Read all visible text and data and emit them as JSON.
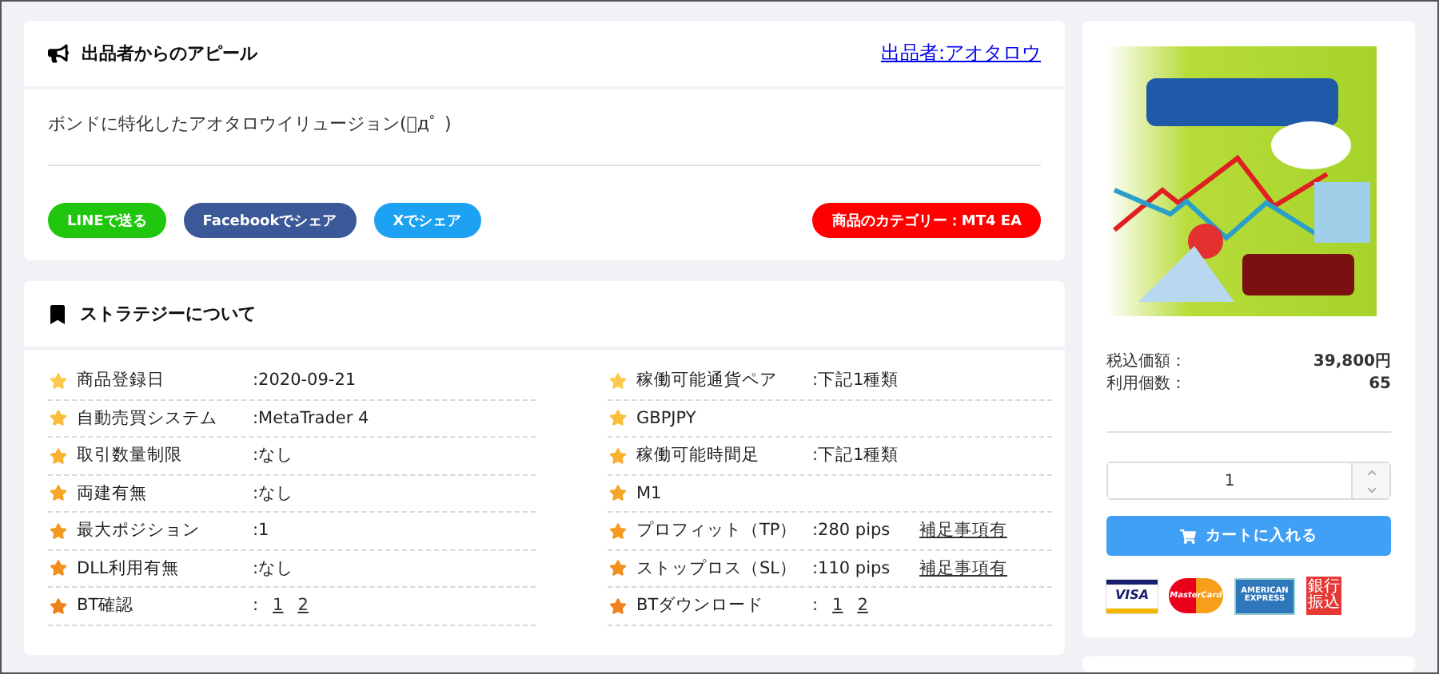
{
  "appeal": {
    "title": "出品者からのアピール",
    "seller_link": "出品者:アオタロウ",
    "text": "ボンドに特化したアオタロウイリュージョン(ﾟдﾟ )",
    "share_buttons": [
      {
        "label": "LINEで送る",
        "color": "#1fc60d"
      },
      {
        "label": "Facebookでシェア",
        "color": "#3b5998"
      },
      {
        "label": "Xでシェア",
        "color": "#1da1f2"
      }
    ],
    "category": "商品のカテゴリー：MT4 EA"
  },
  "strategy": {
    "title": "ストラテジーについて",
    "left": [
      {
        "label": "商品登録日",
        "value": ":2020-09-21",
        "color": "#fcc94a"
      },
      {
        "label": "自動売買システム",
        "value": ":MetaTrader 4",
        "color": "#fbbd3a"
      },
      {
        "label": "取引数量制限",
        "value": ":なし",
        "color": "#f9b12f"
      },
      {
        "label": "両建有無",
        "value": ":なし",
        "color": "#f7a526"
      },
      {
        "label": "最大ポジション",
        "value": ":1",
        "color": "#f59a20"
      },
      {
        "label": "DLL利用有無",
        "value": ":なし",
        "color": "#f28f1d"
      },
      {
        "label": "BT確認",
        "value": ":",
        "links": [
          "1",
          "2"
        ],
        "color": "#ef821c"
      }
    ],
    "right": [
      {
        "label": "稼働可能通貨ペア",
        "value": ":下記1種類",
        "color": "#fcc94a"
      },
      {
        "label": "GBPJPY",
        "color": "#fbbd3a"
      },
      {
        "label": "稼働可能時間足",
        "value": ":下記1種類",
        "color": "#f9b12f"
      },
      {
        "label": "M1",
        "color": "#f7a526"
      },
      {
        "label": "プロフィット（TP）",
        "value": ":280 pips",
        "note": "補足事項有",
        "color": "#f59a20"
      },
      {
        "label": "ストップロス（SL）",
        "value": ":110 pips",
        "note": "補足事項有",
        "color": "#f28f1d"
      },
      {
        "label": "BTダウンロード",
        "value": ":",
        "links": [
          "1",
          "2"
        ],
        "color": "#ef821c"
      }
    ]
  },
  "product": {
    "price_label": "税込価額：",
    "price": "39,800円",
    "count_label": "利用個数：",
    "count": "65",
    "quantity": "1",
    "cart_button": "カートに入れる",
    "payments": [
      {
        "kind": "visa",
        "label": "VISA"
      },
      {
        "kind": "mastercard",
        "label": "MasterCard"
      },
      {
        "kind": "amex",
        "label": "AMERICAN EXPRESS"
      },
      {
        "kind": "bank",
        "label": "銀行振込"
      }
    ]
  }
}
